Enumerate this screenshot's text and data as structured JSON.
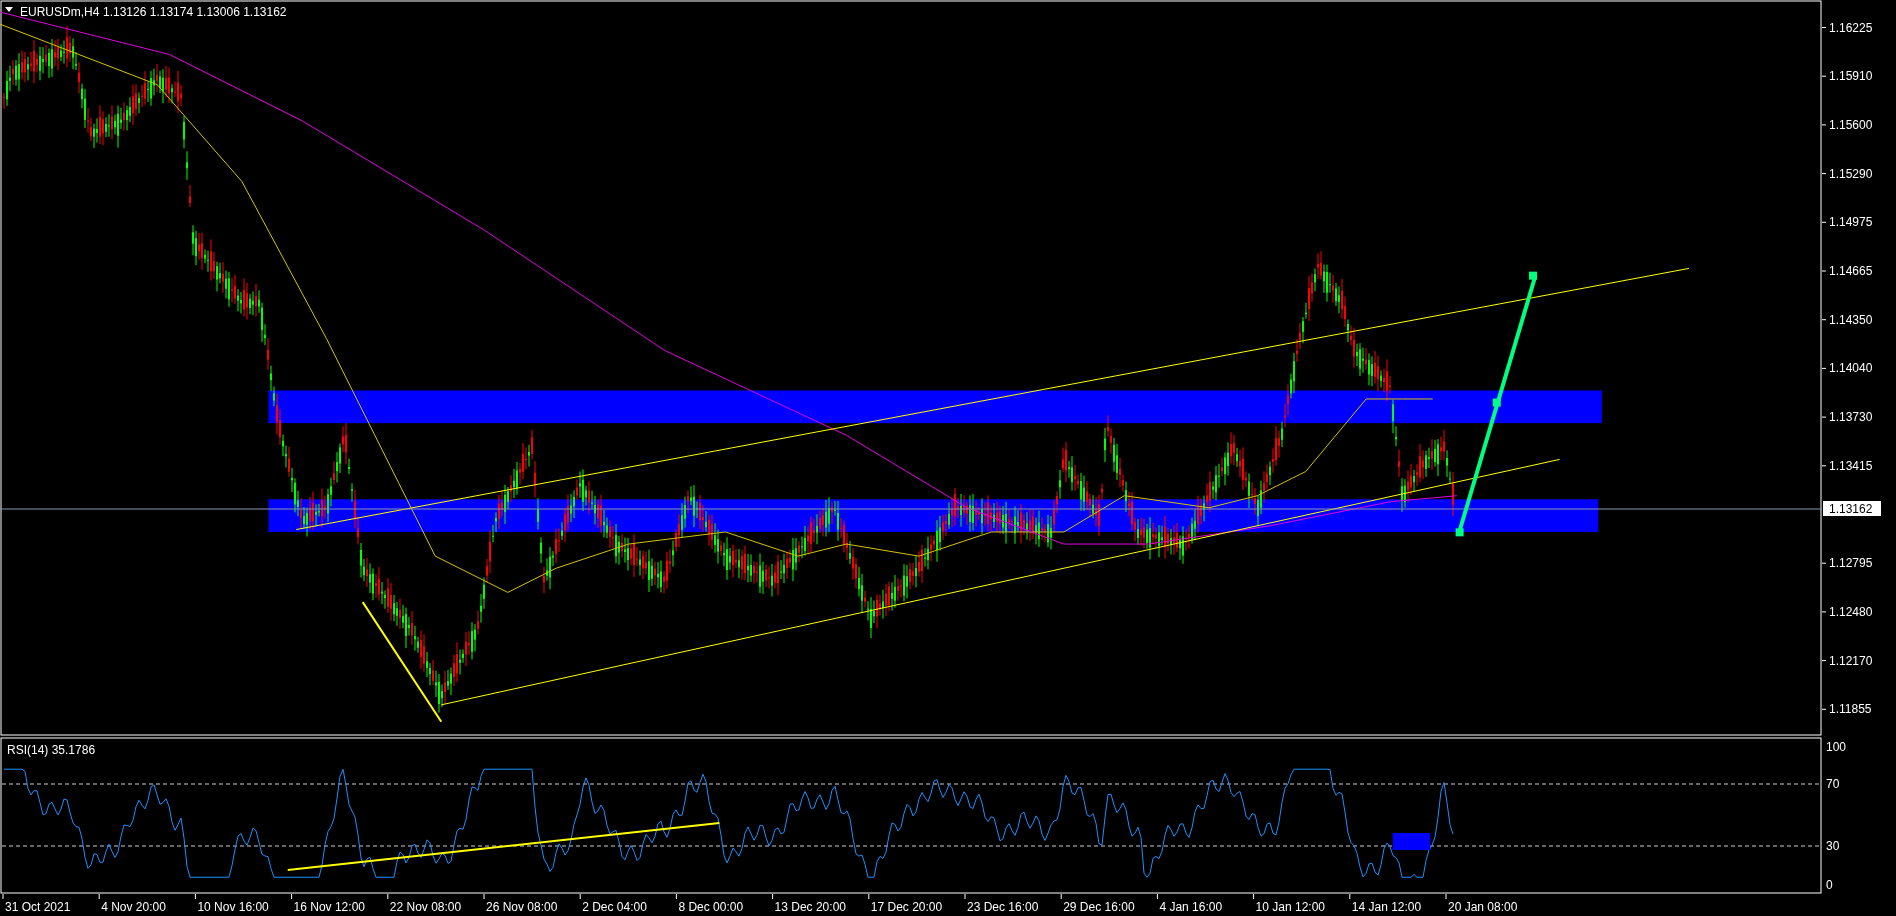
{
  "chart": {
    "symbol": "EURUSDm,H4",
    "quote": "1.13126 1.13174 1.13006 1.13162",
    "current_price": "1.13162"
  },
  "price_axis": [
    "1.16225",
    "1.15910",
    "1.15600",
    "1.15290",
    "1.14975",
    "1.14665",
    "1.14350",
    "1.14040",
    "1.13730",
    "1.13415",
    "1.12795",
    "1.12480",
    "1.12170",
    "1.11855"
  ],
  "rsi": {
    "label": "RSI(14) 35.1786",
    "axis": [
      "100",
      "70",
      "30",
      "0"
    ]
  },
  "time_axis": [
    "31 Oct 2021",
    "4 Nov 20:00",
    "10 Nov 16:00",
    "16 Nov 12:00",
    "22 Nov 08:00",
    "26 Nov 08:00",
    "2 Dec 04:00",
    "8 Dec 00:00",
    "13 Dec 20:00",
    "17 Dec 20:00",
    "23 Dec 16:00",
    "29 Dec 16:00",
    "4 Jan 16:00",
    "10 Jan 12:00",
    "14 Jan 12:00",
    "20 Jan 08:00"
  ]
}
